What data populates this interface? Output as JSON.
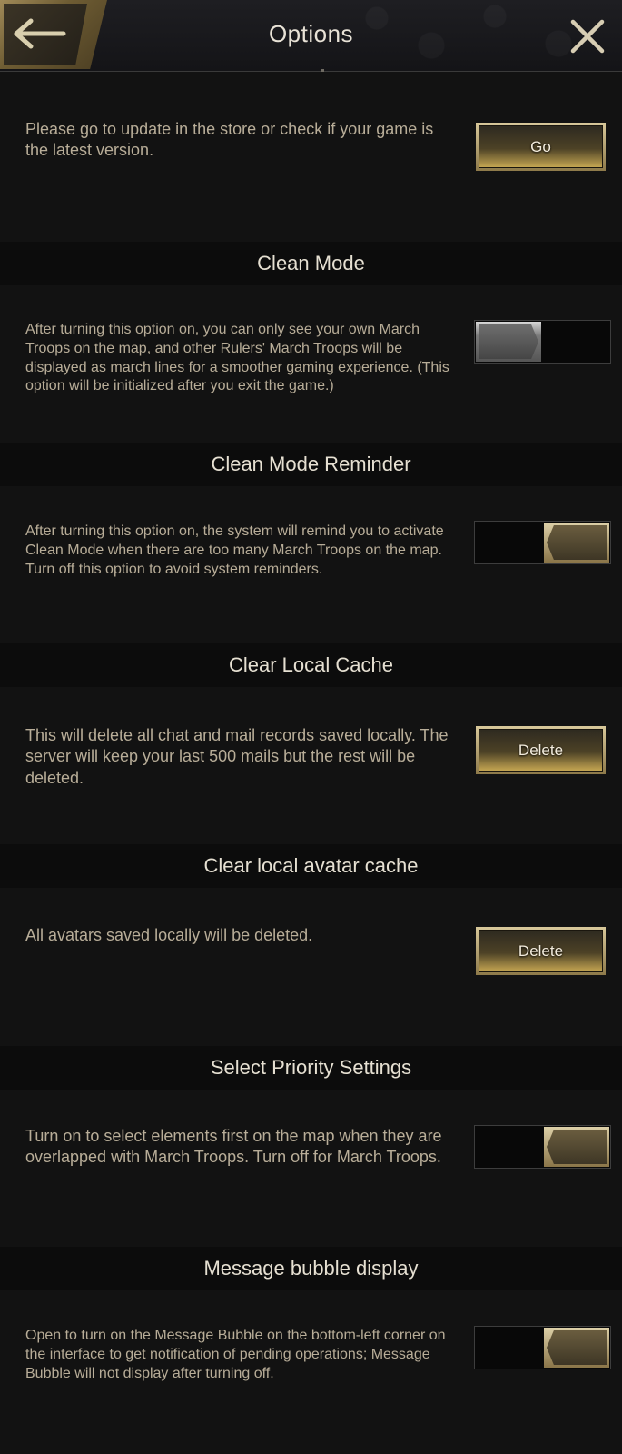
{
  "header": {
    "title": "Options"
  },
  "update": {
    "description": "Please go to update in the store or check if your game is the latest version.",
    "button_label": "Go"
  },
  "sections": [
    {
      "title": "Clean Mode",
      "description": "After turning this option on, you can only see your own March Troops on the map, and other Rulers' March Troops will be displayed as march lines for a smoother gaming experience. (This option will be initialized after you exit the game.)",
      "toggle_state": "off"
    },
    {
      "title": "Clean Mode Reminder",
      "description": "After turning this option on, the system will remind you to activate Clean Mode when there are too many March Troops on the map. Turn off this option to avoid system reminders.",
      "toggle_state": "on"
    },
    {
      "title": "Clear Local Cache",
      "description": "This will delete all chat and mail records saved locally. The server will keep your last 500 mails but the rest will be deleted.",
      "button_label": "Delete"
    },
    {
      "title": "Clear local avatar cache",
      "description": "All avatars saved locally will be deleted.",
      "button_label": "Delete"
    },
    {
      "title": "Select Priority Settings",
      "description": "Turn on to select elements first on the map when they are overlapped with March Troops. Turn off for March Troops.",
      "toggle_state": "on"
    },
    {
      "title": "Message bubble display",
      "description": "Open to turn on the Message Bubble on the bottom-left corner on the interface to get notification of pending operations; Message Bubble will not display after turning off.",
      "toggle_state": "on"
    }
  ],
  "colors": {
    "background": "#121212",
    "section_header_bg": "#0c0c0c",
    "gold_accent": "#c4a552",
    "text": "#b8ad98"
  }
}
